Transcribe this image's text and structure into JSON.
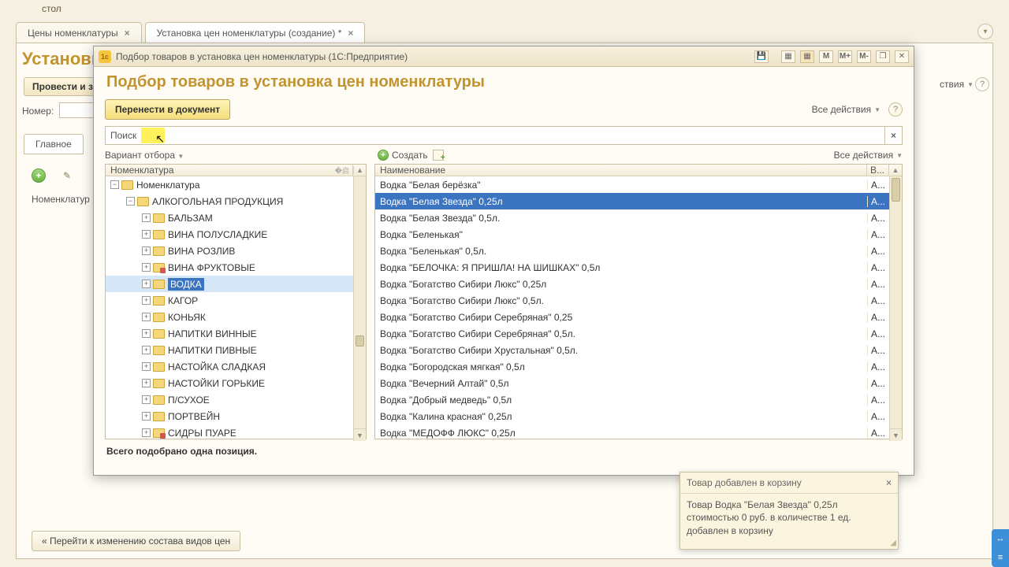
{
  "top_tab": "стол",
  "tabs": [
    {
      "label": "Цены номенклатуры",
      "closable": true,
      "active": false
    },
    {
      "label": "Установка цен номенклатуры (создание) *",
      "closable": true,
      "active": true
    }
  ],
  "page": {
    "title_fragment": "Установк",
    "btn_fragment": "Провести и з",
    "nomer": "Номер:",
    "tab_label": "Главное",
    "col_label": "Номенклатур",
    "bottom_btn": "«  Перейти к изменению состава видов цен",
    "actions": "ствия",
    "all_actions_suffix": "Все действия"
  },
  "modal": {
    "window_title": "Подбор товаров в установка цен номенклатуры  (1С:Предприятие)",
    "title": "Подбор товаров в установка цен номенклатуры",
    "transfer_btn": "Перенести в документ",
    "all_actions": "Все действия",
    "search_label": "Поиск",
    "filter_label": "Вариант отбора",
    "create_label": "Создать",
    "left_col": "Номенклатура",
    "right_col": "Наименование",
    "right_col2": "В...",
    "status": "Всего подобрано одна позиция.",
    "titlebar_buttons": [
      "M",
      "M+",
      "M-"
    ]
  },
  "tree": [
    {
      "indent": 0,
      "exp": "minus",
      "label": "Номенклатура",
      "red": false
    },
    {
      "indent": 1,
      "exp": "minus",
      "label": "АЛКОГОЛЬНАЯ ПРОДУКЦИЯ",
      "red": false
    },
    {
      "indent": 2,
      "exp": "plus",
      "label": "БАЛЬЗАМ",
      "red": false
    },
    {
      "indent": 2,
      "exp": "plus",
      "label": "ВИНА ПОЛУСЛАДКИЕ",
      "red": false
    },
    {
      "indent": 2,
      "exp": "plus",
      "label": "ВИНА РОЗЛИВ",
      "red": false
    },
    {
      "indent": 2,
      "exp": "plus",
      "label": "ВИНА ФРУКТОВЫЕ",
      "red": true
    },
    {
      "indent": 2,
      "exp": "plus",
      "label": "ВОДКА",
      "red": false,
      "selected": true
    },
    {
      "indent": 2,
      "exp": "plus",
      "label": "КАГОР",
      "red": false
    },
    {
      "indent": 2,
      "exp": "plus",
      "label": "КОНЬЯК",
      "red": false
    },
    {
      "indent": 2,
      "exp": "plus",
      "label": "НАПИТКИ ВИННЫЕ",
      "red": false
    },
    {
      "indent": 2,
      "exp": "plus",
      "label": "НАПИТКИ ПИВНЫЕ",
      "red": false
    },
    {
      "indent": 2,
      "exp": "plus",
      "label": "НАСТОЙКА СЛАДКАЯ",
      "red": false
    },
    {
      "indent": 2,
      "exp": "plus",
      "label": "НАСТОЙКИ ГОРЬКИЕ",
      "red": false
    },
    {
      "indent": 2,
      "exp": "plus",
      "label": "П/СУХОЕ",
      "red": false
    },
    {
      "indent": 2,
      "exp": "plus",
      "label": "ПОРТВЕЙН",
      "red": false
    },
    {
      "indent": 2,
      "exp": "plus",
      "label": "СИДРЫ ПУАРЕ",
      "red": true
    }
  ],
  "items": [
    {
      "name": "Водка \"Белая берёзка\"",
      "b": "А..."
    },
    {
      "name": "Водка \"Белая Звезда\" 0,25л",
      "b": "А...",
      "selected": true
    },
    {
      "name": "Водка \"Белая Звезда\" 0,5л.",
      "b": "А..."
    },
    {
      "name": "Водка \"Беленькая\"",
      "b": "А..."
    },
    {
      "name": "Водка \"Беленькая\" 0,5л.",
      "b": "А..."
    },
    {
      "name": "Водка \"БЕЛОЧКА: Я ПРИШЛА! НА ШИШКАХ\" 0,5л",
      "b": "А..."
    },
    {
      "name": "Водка \"Богатство Сибири Люкс\" 0,25л",
      "b": "А..."
    },
    {
      "name": "Водка \"Богатство Сибири Люкс\" 0,5л.",
      "b": "А..."
    },
    {
      "name": "Водка \"Богатство Сибири Серебряная\" 0,25",
      "b": "А..."
    },
    {
      "name": "Водка \"Богатство Сибири Серебряная\" 0,5л.",
      "b": "А..."
    },
    {
      "name": "Водка \"Богатство Сибири Хрустальная\" 0,5л.",
      "b": "А..."
    },
    {
      "name": "Водка \"Богородская мягкая\" 0,5л",
      "b": "А..."
    },
    {
      "name": "Водка \"Вечерний Алтай\" 0,5л",
      "b": "А..."
    },
    {
      "name": "Водка \"Добрый медведь\" 0,5л",
      "b": "А..."
    },
    {
      "name": "Водка \"Калина красная\" 0,25л",
      "b": "А..."
    },
    {
      "name": "Водка \"МЕДОФФ ЛЮКС\" 0,25л",
      "b": "А..."
    }
  ],
  "toast": {
    "title": "Товар добавлен в корзину",
    "body": "Товар Водка \"Белая Звезда\" 0,25л стоимостью 0 руб. в количестве 1 ед. добавлен в корзину"
  }
}
